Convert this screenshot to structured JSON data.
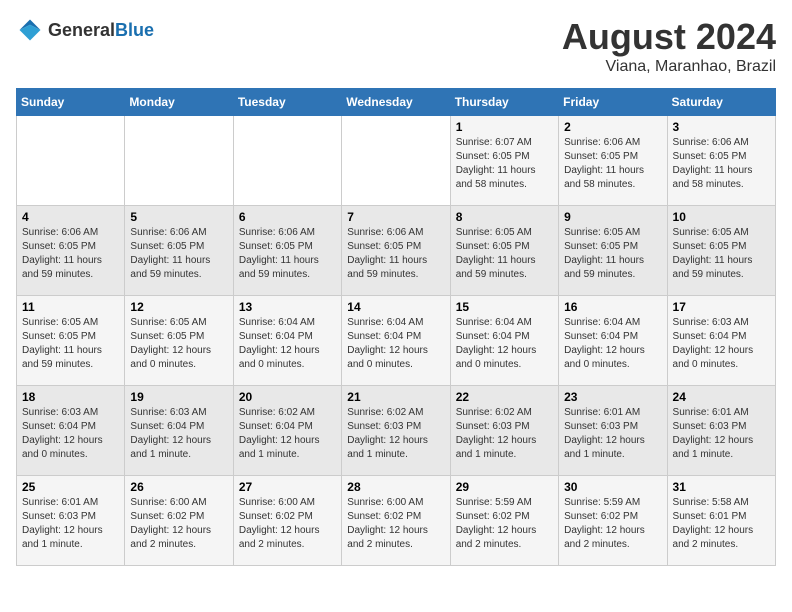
{
  "logo": {
    "general": "General",
    "blue": "Blue"
  },
  "title": "August 2024",
  "subtitle": "Viana, Maranhao, Brazil",
  "weekdays": [
    "Sunday",
    "Monday",
    "Tuesday",
    "Wednesday",
    "Thursday",
    "Friday",
    "Saturday"
  ],
  "weeks": [
    [
      {
        "day": "",
        "info": ""
      },
      {
        "day": "",
        "info": ""
      },
      {
        "day": "",
        "info": ""
      },
      {
        "day": "",
        "info": ""
      },
      {
        "day": "1",
        "info": "Sunrise: 6:07 AM\nSunset: 6:05 PM\nDaylight: 11 hours\nand 58 minutes."
      },
      {
        "day": "2",
        "info": "Sunrise: 6:06 AM\nSunset: 6:05 PM\nDaylight: 11 hours\nand 58 minutes."
      },
      {
        "day": "3",
        "info": "Sunrise: 6:06 AM\nSunset: 6:05 PM\nDaylight: 11 hours\nand 58 minutes."
      }
    ],
    [
      {
        "day": "4",
        "info": "Sunrise: 6:06 AM\nSunset: 6:05 PM\nDaylight: 11 hours\nand 59 minutes."
      },
      {
        "day": "5",
        "info": "Sunrise: 6:06 AM\nSunset: 6:05 PM\nDaylight: 11 hours\nand 59 minutes."
      },
      {
        "day": "6",
        "info": "Sunrise: 6:06 AM\nSunset: 6:05 PM\nDaylight: 11 hours\nand 59 minutes."
      },
      {
        "day": "7",
        "info": "Sunrise: 6:06 AM\nSunset: 6:05 PM\nDaylight: 11 hours\nand 59 minutes."
      },
      {
        "day": "8",
        "info": "Sunrise: 6:05 AM\nSunset: 6:05 PM\nDaylight: 11 hours\nand 59 minutes."
      },
      {
        "day": "9",
        "info": "Sunrise: 6:05 AM\nSunset: 6:05 PM\nDaylight: 11 hours\nand 59 minutes."
      },
      {
        "day": "10",
        "info": "Sunrise: 6:05 AM\nSunset: 6:05 PM\nDaylight: 11 hours\nand 59 minutes."
      }
    ],
    [
      {
        "day": "11",
        "info": "Sunrise: 6:05 AM\nSunset: 6:05 PM\nDaylight: 11 hours\nand 59 minutes."
      },
      {
        "day": "12",
        "info": "Sunrise: 6:05 AM\nSunset: 6:05 PM\nDaylight: 12 hours\nand 0 minutes."
      },
      {
        "day": "13",
        "info": "Sunrise: 6:04 AM\nSunset: 6:04 PM\nDaylight: 12 hours\nand 0 minutes."
      },
      {
        "day": "14",
        "info": "Sunrise: 6:04 AM\nSunset: 6:04 PM\nDaylight: 12 hours\nand 0 minutes."
      },
      {
        "day": "15",
        "info": "Sunrise: 6:04 AM\nSunset: 6:04 PM\nDaylight: 12 hours\nand 0 minutes."
      },
      {
        "day": "16",
        "info": "Sunrise: 6:04 AM\nSunset: 6:04 PM\nDaylight: 12 hours\nand 0 minutes."
      },
      {
        "day": "17",
        "info": "Sunrise: 6:03 AM\nSunset: 6:04 PM\nDaylight: 12 hours\nand 0 minutes."
      }
    ],
    [
      {
        "day": "18",
        "info": "Sunrise: 6:03 AM\nSunset: 6:04 PM\nDaylight: 12 hours\nand 0 minutes."
      },
      {
        "day": "19",
        "info": "Sunrise: 6:03 AM\nSunset: 6:04 PM\nDaylight: 12 hours\nand 1 minute."
      },
      {
        "day": "20",
        "info": "Sunrise: 6:02 AM\nSunset: 6:04 PM\nDaylight: 12 hours\nand 1 minute."
      },
      {
        "day": "21",
        "info": "Sunrise: 6:02 AM\nSunset: 6:03 PM\nDaylight: 12 hours\nand 1 minute."
      },
      {
        "day": "22",
        "info": "Sunrise: 6:02 AM\nSunset: 6:03 PM\nDaylight: 12 hours\nand 1 minute."
      },
      {
        "day": "23",
        "info": "Sunrise: 6:01 AM\nSunset: 6:03 PM\nDaylight: 12 hours\nand 1 minute."
      },
      {
        "day": "24",
        "info": "Sunrise: 6:01 AM\nSunset: 6:03 PM\nDaylight: 12 hours\nand 1 minute."
      }
    ],
    [
      {
        "day": "25",
        "info": "Sunrise: 6:01 AM\nSunset: 6:03 PM\nDaylight: 12 hours\nand 1 minute."
      },
      {
        "day": "26",
        "info": "Sunrise: 6:00 AM\nSunset: 6:02 PM\nDaylight: 12 hours\nand 2 minutes."
      },
      {
        "day": "27",
        "info": "Sunrise: 6:00 AM\nSunset: 6:02 PM\nDaylight: 12 hours\nand 2 minutes."
      },
      {
        "day": "28",
        "info": "Sunrise: 6:00 AM\nSunset: 6:02 PM\nDaylight: 12 hours\nand 2 minutes."
      },
      {
        "day": "29",
        "info": "Sunrise: 5:59 AM\nSunset: 6:02 PM\nDaylight: 12 hours\nand 2 minutes."
      },
      {
        "day": "30",
        "info": "Sunrise: 5:59 AM\nSunset: 6:02 PM\nDaylight: 12 hours\nand 2 minutes."
      },
      {
        "day": "31",
        "info": "Sunrise: 5:58 AM\nSunset: 6:01 PM\nDaylight: 12 hours\nand 2 minutes."
      }
    ]
  ]
}
